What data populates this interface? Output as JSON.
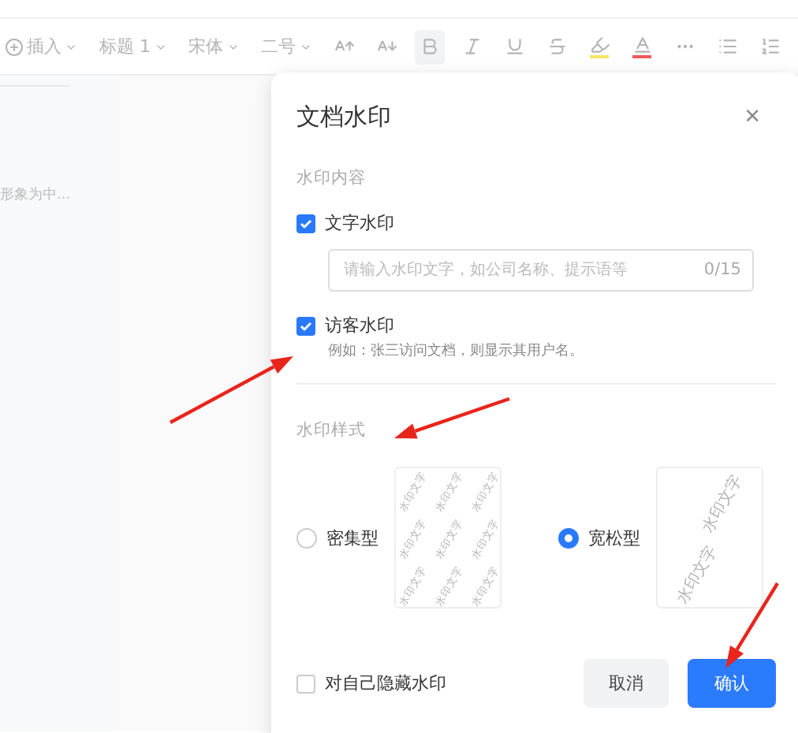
{
  "toolbar": {
    "items": [
      {
        "kind": "insert",
        "label": "插入"
      },
      {
        "kind": "dropdown",
        "label": "标题 1"
      },
      {
        "kind": "dropdown",
        "label": "宋体"
      },
      {
        "kind": "dropdown",
        "label": "二号"
      },
      {
        "kind": "grow"
      },
      {
        "kind": "shrink"
      },
      {
        "kind": "bold",
        "selected": true
      },
      {
        "kind": "italic",
        "selected": false
      },
      {
        "kind": "underline",
        "selected": false
      },
      {
        "kind": "strike",
        "selected": false
      },
      {
        "kind": "highlight",
        "color": "#f5e663"
      },
      {
        "kind": "fontcolor",
        "color": "#f05a5a"
      },
      {
        "kind": "more"
      },
      {
        "kind": "bullets"
      },
      {
        "kind": "numbers"
      }
    ]
  },
  "outline": {
    "text": "形象为中..."
  },
  "dialog": {
    "title": "文档水印",
    "close": "×",
    "content_label": "水印内容",
    "options": [
      {
        "label": "文字水印",
        "checked": true,
        "field": {
          "placeholder": "请输入水印文字，如公司名称、提示语等",
          "counter": "0/15"
        }
      },
      {
        "label": "访客水印",
        "checked": true,
        "hint": "例如：张三访问文档，则显示其用户名。"
      }
    ],
    "style_label": "水印样式",
    "styles": [
      {
        "label": "密集型",
        "selected": false,
        "preview": [
          "水印文字",
          "水印文字",
          "水印文字",
          "水印文字",
          "水印文字",
          "水印文字",
          "水印文字",
          "水印文字",
          "水印文字"
        ]
      },
      {
        "label": "宽松型",
        "selected": true,
        "preview": [
          "水印文字",
          "水印文字"
        ]
      }
    ],
    "hide_self": {
      "label": "对自己隐藏水印",
      "checked": false
    },
    "buttons": [
      {
        "label": "取消",
        "kind": "secondary"
      },
      {
        "label": "确认",
        "kind": "primary"
      }
    ]
  },
  "annotations": [
    {
      "kind": "arrow"
    },
    {
      "kind": "arrow"
    },
    {
      "kind": "arrow"
    }
  ]
}
